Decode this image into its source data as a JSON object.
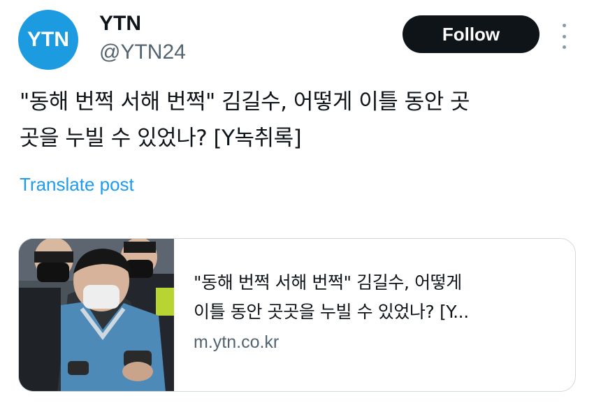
{
  "author": {
    "avatar_text": "YTN",
    "display_name": "YTN",
    "handle": "@YTN24",
    "brand_color": "#1d9be0"
  },
  "actions": {
    "follow_label": "Follow",
    "more_icon": "more-vertical-icon"
  },
  "post": {
    "text_lines": [
      "\"동해 번쩍 서해 번쩍\" 김길수, 어떻게 이틀 동안 곳",
      "곳을 누빌 수 있었나? [Y녹취록]"
    ],
    "translate_label": "Translate post"
  },
  "link_card": {
    "title_lines": [
      "\"동해 번쩍 서해 번쩍\" 김길수, 어떻게",
      "이틀 동안 곳곳을 누빌 수 있었나? [Y..."
    ],
    "domain": "m.ytn.co.kr"
  },
  "colors": {
    "follow_bg": "#0f1419",
    "link_blue": "#1d9bf0",
    "secondary_text": "#536471",
    "card_border": "#cfd9de"
  }
}
